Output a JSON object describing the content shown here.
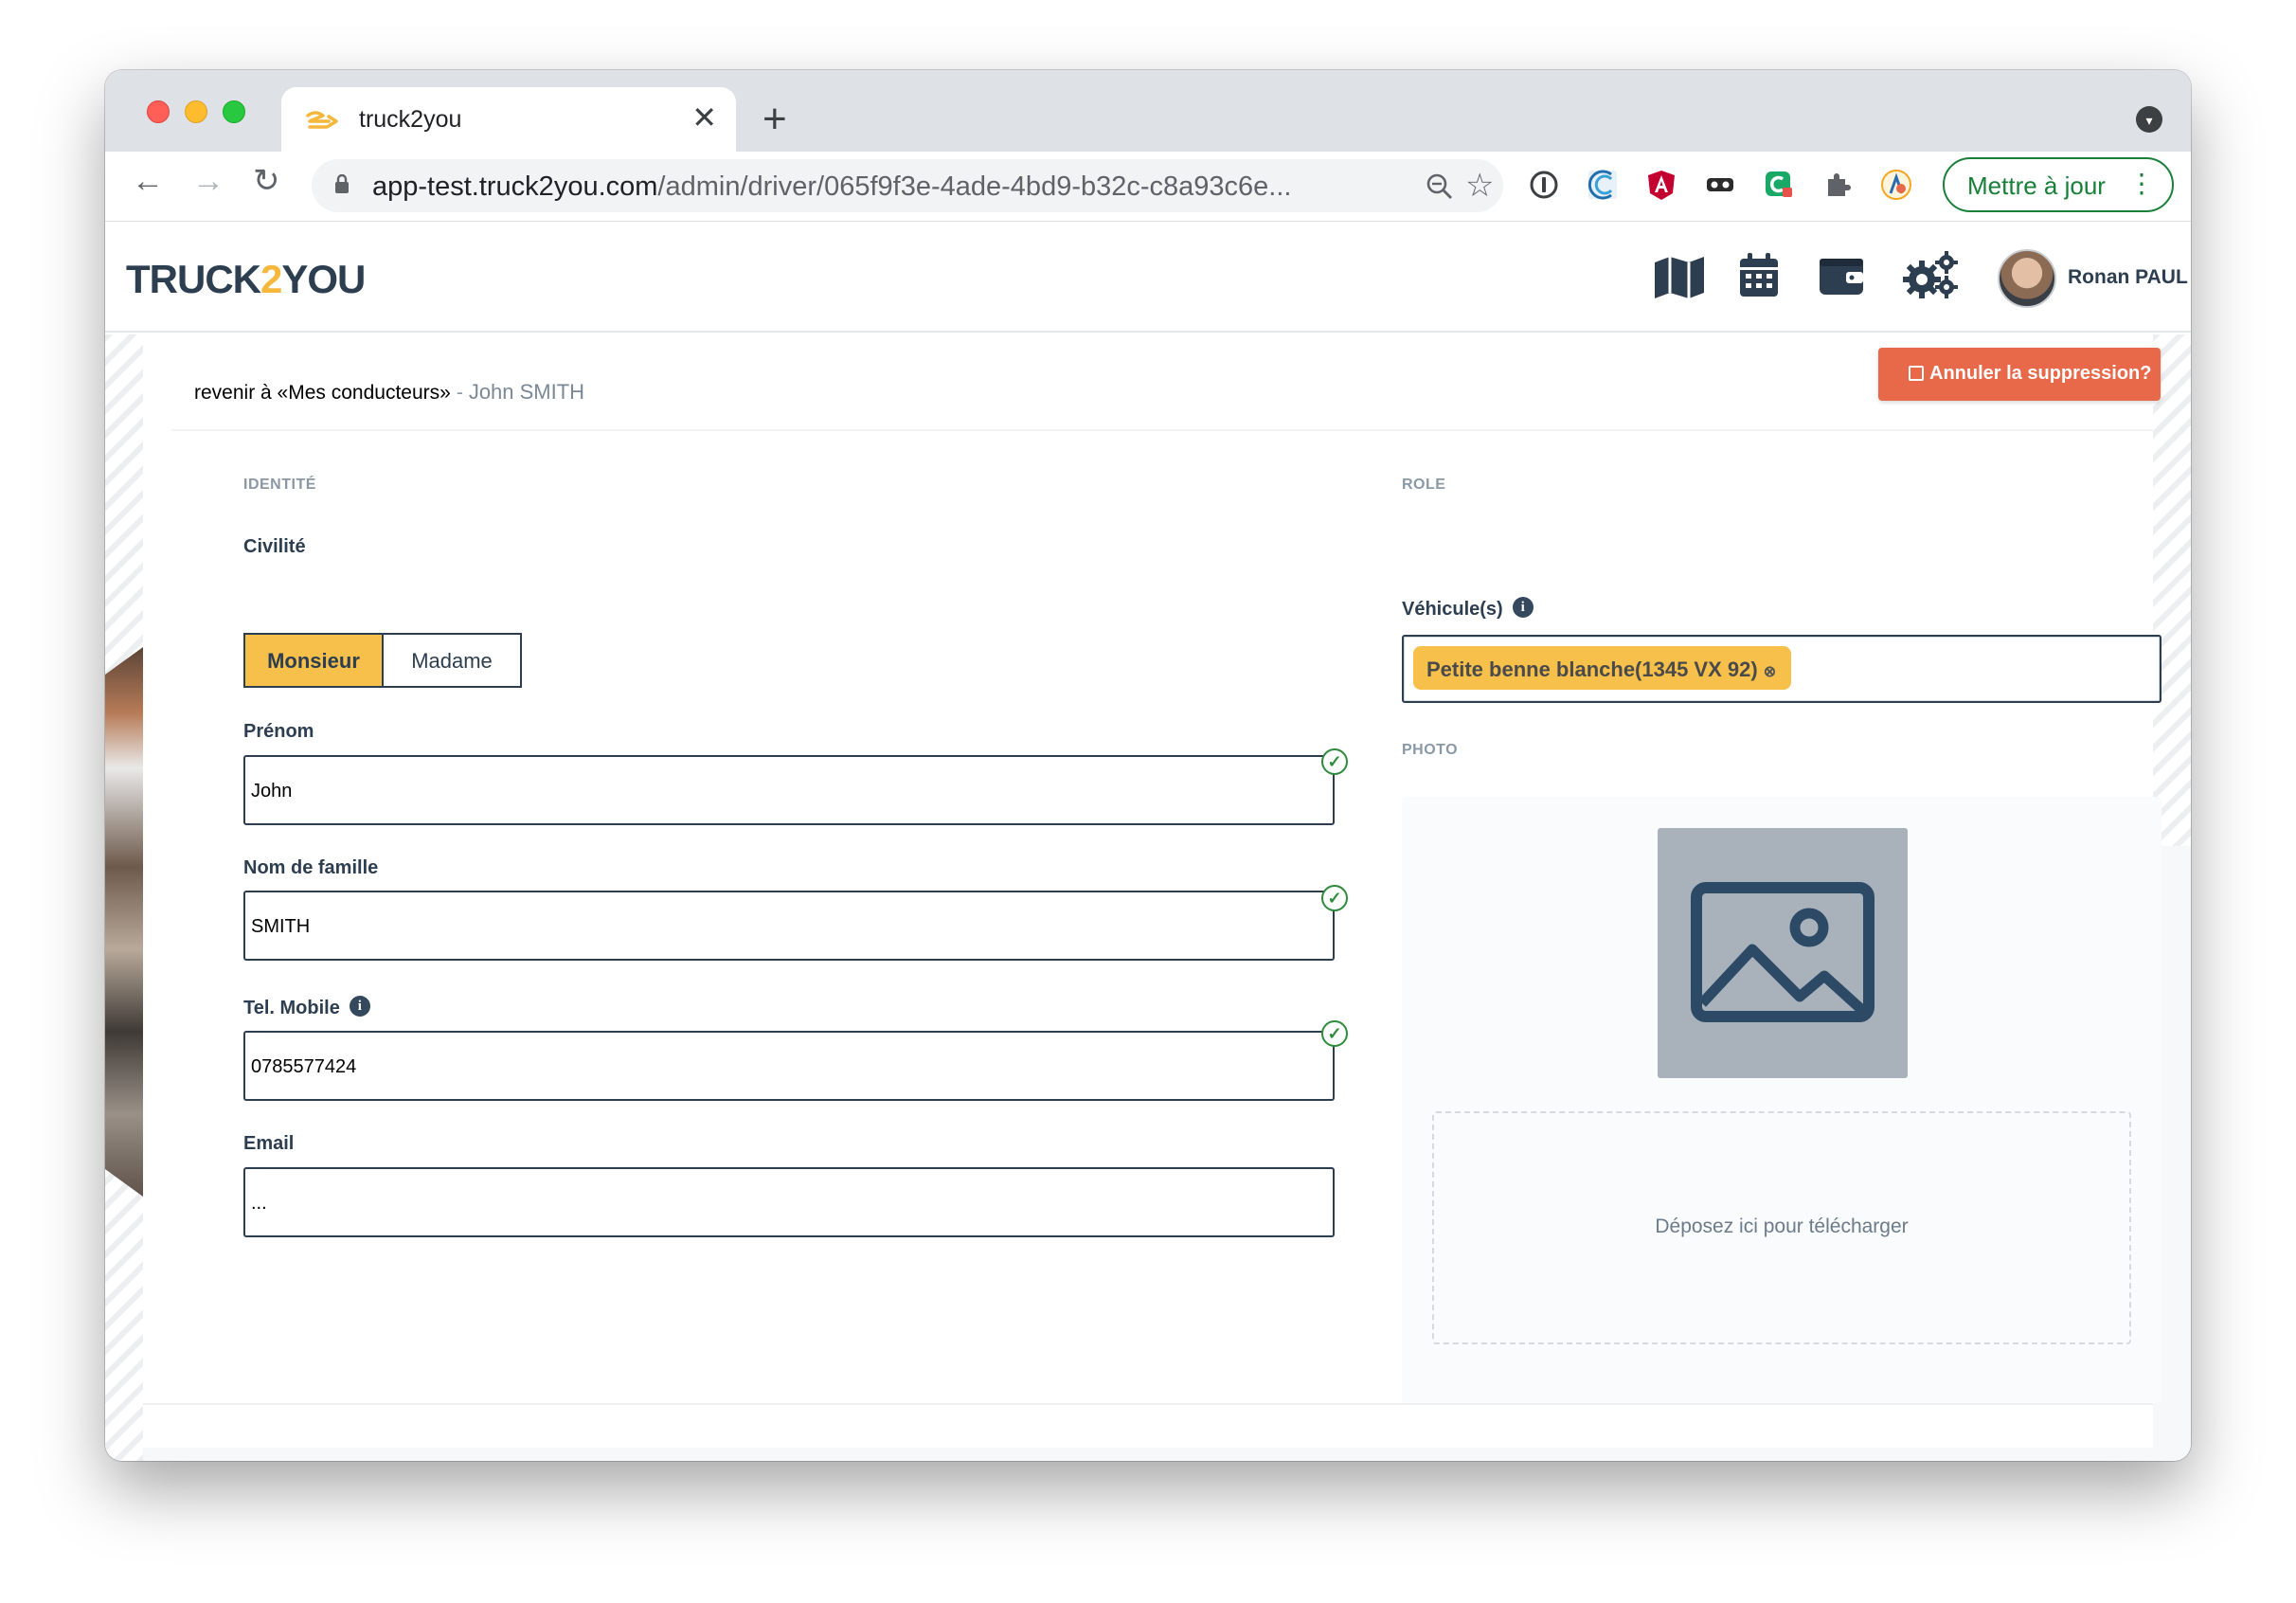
{
  "browser": {
    "tab_title": "truck2you",
    "url_host": "app-test.truck2you.com",
    "url_path": "/admin/driver/065f9f3e-4ade-4bd9-b32c-c8a93c6e...",
    "update_button": "Mettre à jour"
  },
  "header": {
    "logo_left": "TRUCK",
    "logo_mid": "2",
    "logo_right": "YOU",
    "user_name": "Ronan PAUL",
    "icons": [
      "map-icon",
      "calendar-icon",
      "wallet-icon",
      "settings-gears-icon"
    ]
  },
  "breadcrumb": {
    "back_link": "revenir à «Mes conducteurs»",
    "separator": "-",
    "current": "John SMITH"
  },
  "actions": {
    "cancel_delete": "Annuler la suppression?"
  },
  "identity": {
    "section_title": "IDENTITÉ",
    "civility_label": "Civilité",
    "civility_options": [
      "Monsieur",
      "Madame"
    ],
    "civility_selected": "Monsieur",
    "first_name_label": "Prénom",
    "first_name_value": "John",
    "last_name_label": "Nom de famille",
    "last_name_value": "SMITH",
    "mobile_label": "Tel. Mobile",
    "mobile_value": "0785577424",
    "email_label": "Email",
    "email_value": "..."
  },
  "role": {
    "section_title": "ROLE",
    "vehicles_label": "Véhicule(s)",
    "vehicle_tag": "Petite benne blanche(1345 VX 92)"
  },
  "photo": {
    "section_title": "PHOTO",
    "dropzone_text": "Déposez ici pour télécharger"
  },
  "colors": {
    "accent_yellow": "#f7c04a",
    "danger_orange": "#e8684a",
    "text_dark": "#2c3e50",
    "valid_green": "#2e8b3c"
  }
}
